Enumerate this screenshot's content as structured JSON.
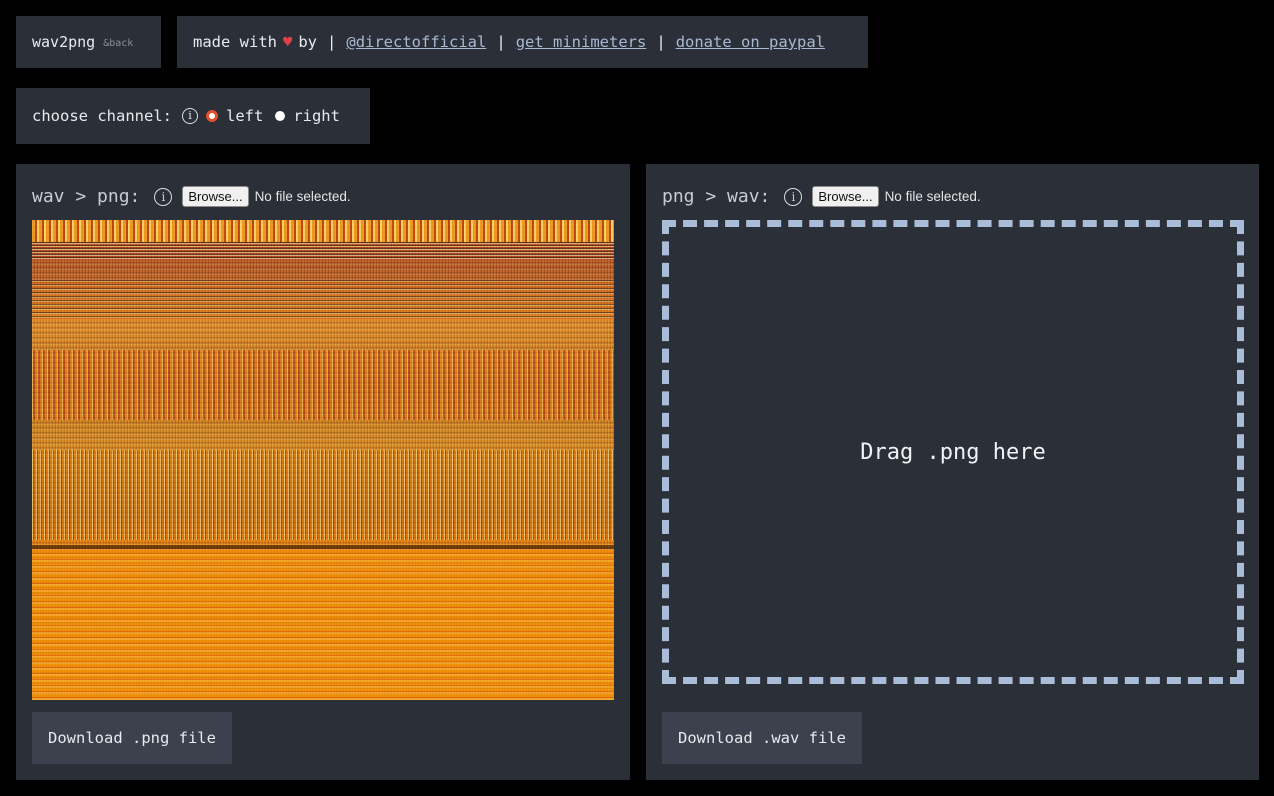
{
  "brand": {
    "name": "wav2png",
    "suffix": "&back"
  },
  "credits": {
    "made_with": "made with",
    "by": "by",
    "sep": "|",
    "link_author": "@directofficial",
    "link_minimeters": "get minimeters",
    "link_donate": "donate on paypal"
  },
  "channel": {
    "label": "choose channel:",
    "info": "i",
    "options": [
      "left",
      "right"
    ],
    "selected": "left"
  },
  "wav_to_png": {
    "heading": "wav > png:",
    "info": "i",
    "browse_label": "Browse...",
    "file_status": "No file selected.",
    "download_label": "Download .png file"
  },
  "png_to_wav": {
    "heading": "png > wav:",
    "info": "i",
    "browse_label": "Browse...",
    "file_status": "No file selected.",
    "drop_label": "Drag .png here",
    "download_label": "Download .wav file"
  },
  "colors": {
    "background": "#000000",
    "panel": "#2a2f38",
    "button": "#3b414d",
    "link": "#a9b9d3",
    "dash": "#a9bcd8",
    "heart": "#e0404a",
    "spectrogram_orange": "#f08800"
  }
}
